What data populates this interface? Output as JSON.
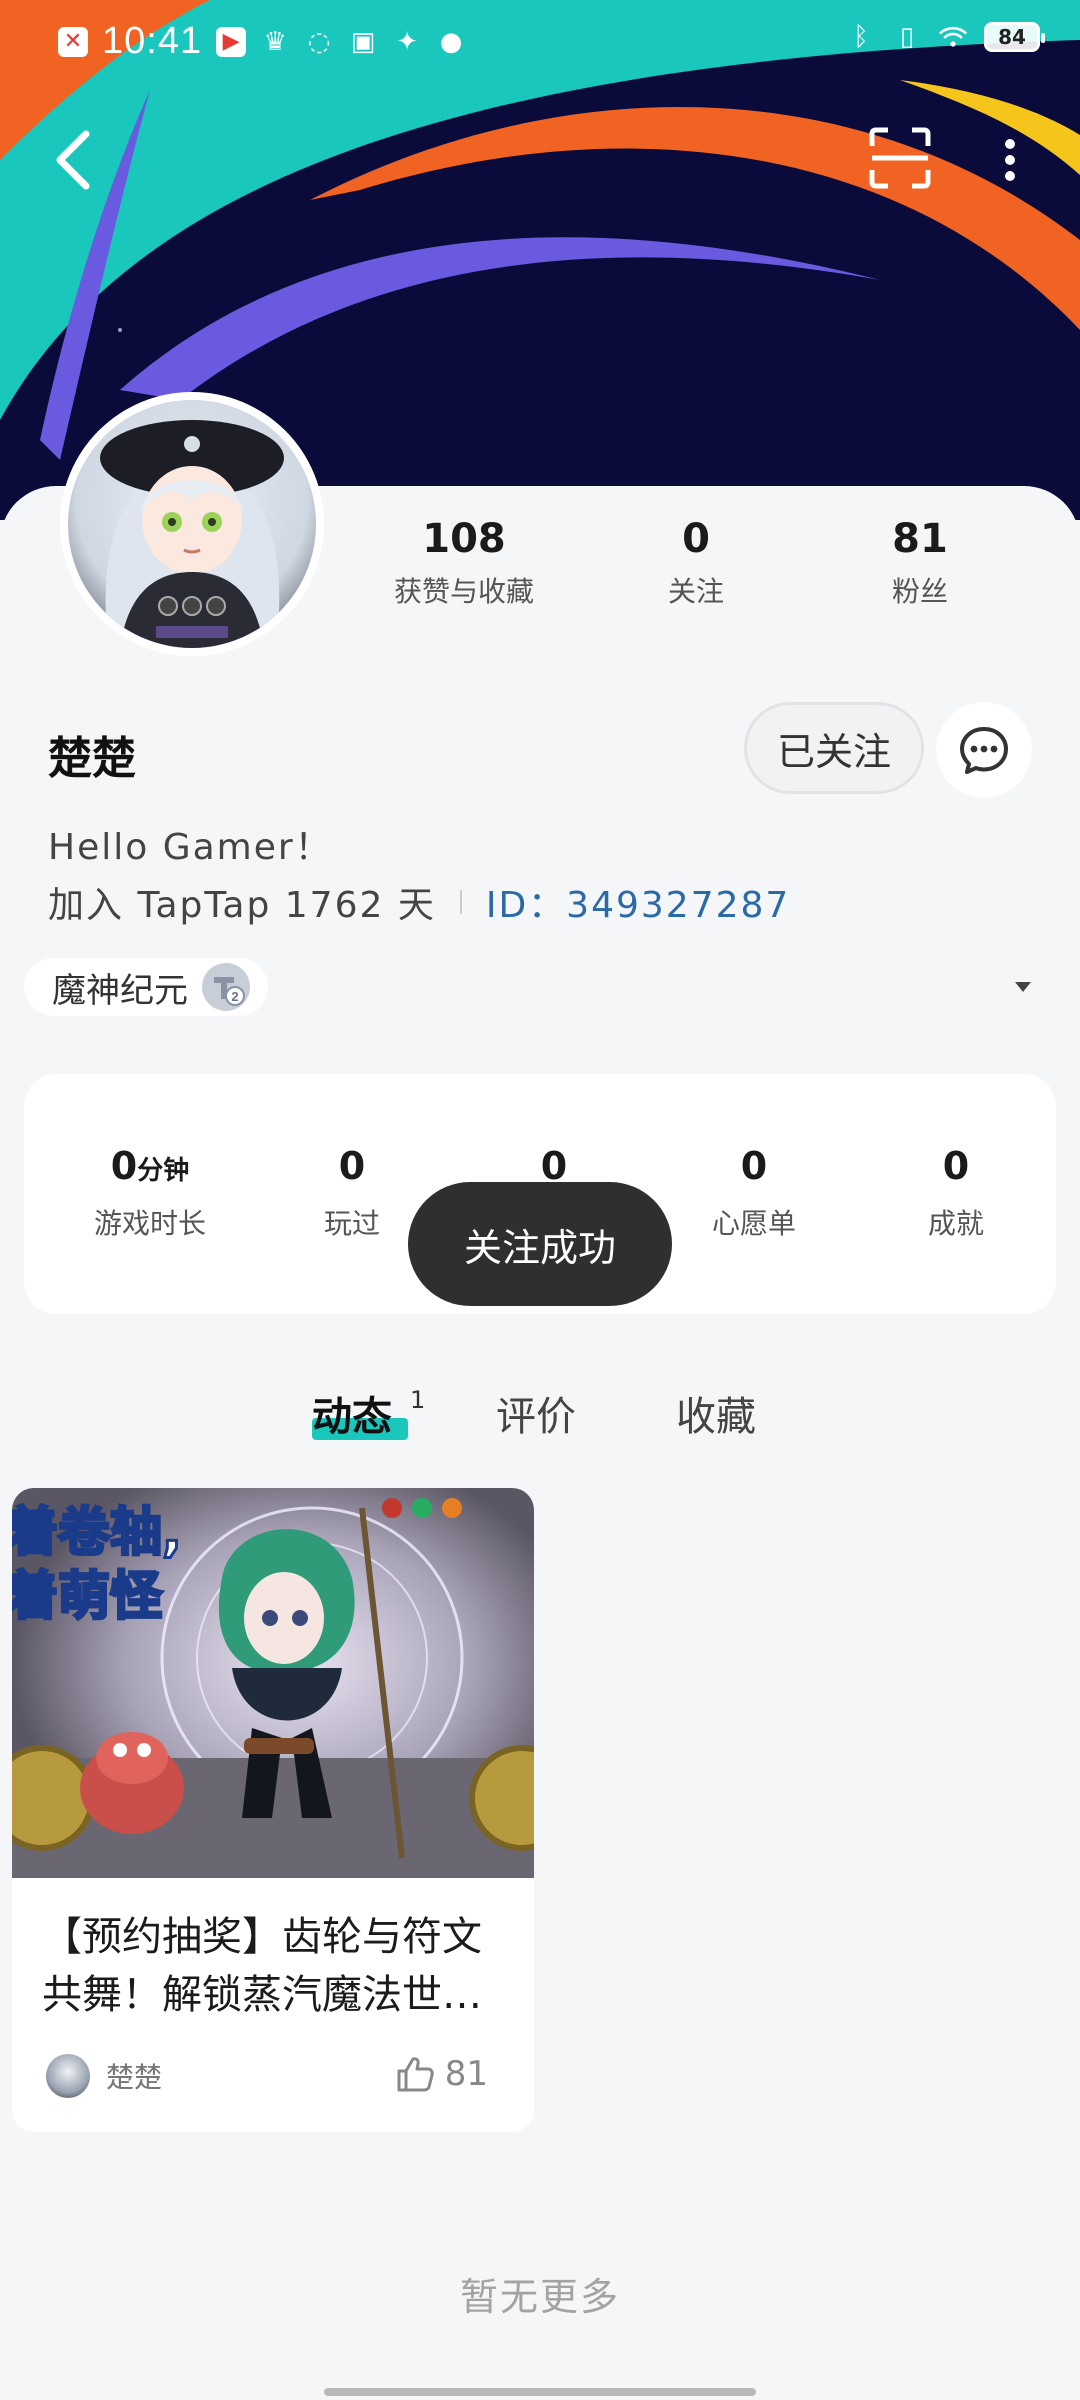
{
  "status_bar": {
    "time": "10:41",
    "battery": "84"
  },
  "colors": {
    "cover_bg": "#0a0b3a",
    "accent_teal": "#19c7bd",
    "stripe_orange": "#f06322",
    "stripe_purple": "#6a5ae0",
    "stripe_yellow": "#f5c51c",
    "id_blue": "#2a6aa8"
  },
  "icons": {
    "back": "back-arrow-icon",
    "scan": "scan-icon",
    "more": "more-vertical-icon",
    "message": "chat-bubble-icon",
    "like": "thumbs-up-icon",
    "caret": "caret-down-icon"
  },
  "profile": {
    "stats": [
      {
        "value": "108",
        "label": "获赞与收藏"
      },
      {
        "value": "0",
        "label": "关注"
      },
      {
        "value": "81",
        "label": "粉丝"
      }
    ],
    "name": "楚楚",
    "follow_button": "已关注",
    "bio": "Hello Gamer！",
    "join_text": "加入 TapTap 1762 天",
    "id_text": "ID：349327287",
    "game_tag": "魔神纪元"
  },
  "play_stats": [
    {
      "value": "0",
      "unit": "分钟",
      "label": "游戏时长"
    },
    {
      "value": "0",
      "label": "玩过"
    },
    {
      "value": "0",
      "label": ""
    },
    {
      "value": "0",
      "label": "心愿单"
    },
    {
      "value": "0",
      "label": "成就"
    }
  ],
  "toast": "关注成功",
  "tabs": [
    {
      "label": "动态",
      "badge": "1",
      "active": true
    },
    {
      "label": "评价"
    },
    {
      "label": "收藏"
    }
  ],
  "post": {
    "title": "【预约抽奖】齿轮与符文共舞！解锁蒸汽魔法世…",
    "banner_text_1": "着卷轴,",
    "banner_text_2": "着萌怪",
    "author": "楚楚",
    "likes": "81"
  },
  "footer": {
    "no_more": "暂无更多"
  }
}
